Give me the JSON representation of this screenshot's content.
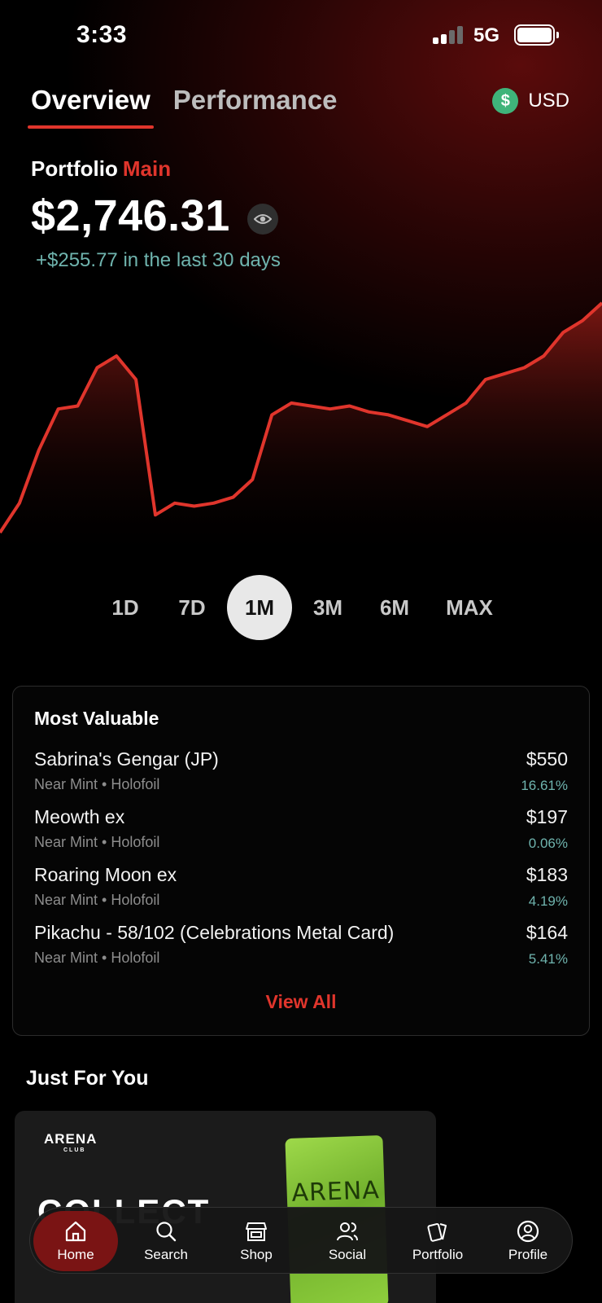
{
  "status_bar": {
    "time": "3:33",
    "network": "5G"
  },
  "tabs": [
    {
      "label": "Overview",
      "active": true
    },
    {
      "label": "Performance",
      "active": false
    }
  ],
  "currency": {
    "icon": "dollar-icon",
    "symbol": "$",
    "label": "USD"
  },
  "portfolio": {
    "label": "Portfolio",
    "name": "Main",
    "value": "$2,746.31",
    "change_text": "+$255.77 in the last 30 days"
  },
  "colors": {
    "accent": "#e0352c",
    "positive": "#6fb4ae",
    "currency_badge": "#3fb47a"
  },
  "chart_data": {
    "type": "area",
    "values": [
      2040,
      2090,
      2180,
      2250,
      2255,
      2320,
      2340,
      2300,
      2070,
      2090,
      2085,
      2090,
      2100,
      2130,
      2240,
      2260,
      2255,
      2250,
      2255,
      2245,
      2240,
      2230,
      2220,
      2240,
      2260,
      2300,
      2310,
      2320,
      2340,
      2380,
      2400,
      2430
    ]
  },
  "ranges": [
    {
      "label": "1D",
      "selected": false
    },
    {
      "label": "7D",
      "selected": false
    },
    {
      "label": "1M",
      "selected": true
    },
    {
      "label": "3M",
      "selected": false
    },
    {
      "label": "6M",
      "selected": false
    },
    {
      "label": "MAX",
      "selected": false
    }
  ],
  "most_valuable": {
    "title": "Most Valuable",
    "items": [
      {
        "name": "Sabrina's Gengar (JP)",
        "condition": "Near Mint • Holofoil",
        "price": "$550",
        "pct": "16.61%"
      },
      {
        "name": "Meowth ex",
        "condition": "Near Mint • Holofoil",
        "price": "$197",
        "pct": "0.06%"
      },
      {
        "name": "Roaring Moon ex",
        "condition": "Near Mint • Holofoil",
        "price": "$183",
        "pct": "4.19%"
      },
      {
        "name": "Pikachu - 58/102 (Celebrations Metal Card)",
        "condition": "Near Mint • Holofoil",
        "price": "$164",
        "pct": "5.41%"
      }
    ],
    "view_all": "View All"
  },
  "just_for_you": {
    "title": "Just For You",
    "promo": {
      "logo": "ARENA",
      "logo_sub": "CLUB",
      "headline": "COLLECT",
      "pack_text": "ARENA"
    }
  },
  "nav": [
    {
      "label": "Home",
      "icon": "home-icon",
      "active": true
    },
    {
      "label": "Search",
      "icon": "search-icon",
      "active": false
    },
    {
      "label": "Shop",
      "icon": "shop-icon",
      "active": false
    },
    {
      "label": "Social",
      "icon": "social-icon",
      "active": false
    },
    {
      "label": "Portfolio",
      "icon": "cards-icon",
      "active": false
    },
    {
      "label": "Profile",
      "icon": "profile-icon",
      "active": false
    }
  ]
}
